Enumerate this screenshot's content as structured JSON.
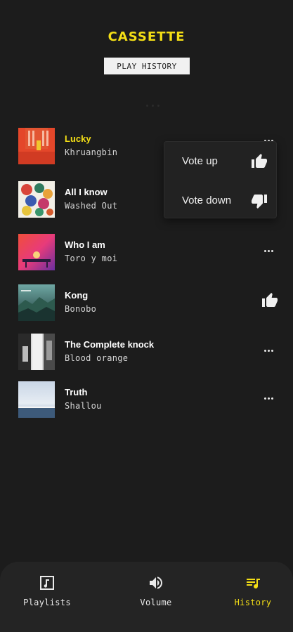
{
  "app": {
    "logo": "CASSETTE",
    "section_label": "PLAY HISTORY"
  },
  "tracks": [
    {
      "title": "Lucky",
      "artist": "Khruangbin",
      "active": true,
      "action": "more"
    },
    {
      "title": "All I know",
      "artist": "Washed Out",
      "active": false,
      "action": "none"
    },
    {
      "title": "Who I am",
      "artist": "Toro y moi",
      "active": false,
      "action": "more"
    },
    {
      "title": "Kong",
      "artist": "Bonobo",
      "active": false,
      "action": "thumb-up"
    },
    {
      "title": "The Complete knock",
      "artist": "Blood orange",
      "active": false,
      "action": "more"
    },
    {
      "title": "Truth",
      "artist": "Shallou",
      "active": false,
      "action": "more"
    }
  ],
  "vote_menu": {
    "up_label": "Vote up",
    "down_label": "Vote down"
  },
  "nav": {
    "playlists": "Playlists",
    "volume": "Volume",
    "history": "History"
  },
  "colors": {
    "accent": "#f3de16",
    "background": "#1c1c1c",
    "nav_bg": "#242424"
  }
}
